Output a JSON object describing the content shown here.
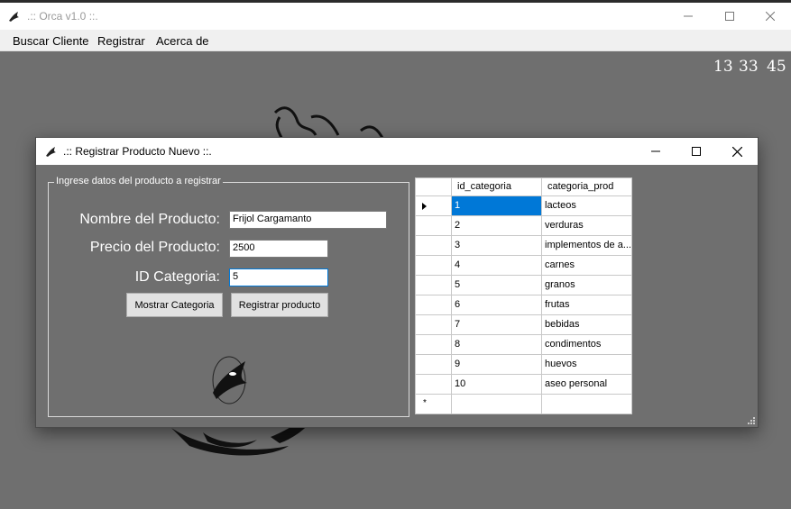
{
  "app": {
    "title": ".:: Orca v1.0 ::.",
    "icon": "orca-icon"
  },
  "menu": {
    "items": [
      "Buscar Cliente",
      "Registrar",
      "Acerca de"
    ]
  },
  "clock": {
    "hours": "13",
    "minutes": "33",
    "seconds": "45"
  },
  "dialog": {
    "title": ".:: Registrar Producto Nuevo ::.",
    "group_title": "Ingrese datos del producto a registrar",
    "labels": {
      "nombre": "Nombre del Producto:",
      "precio": "Precio del Producto:",
      "categoria": "ID Categoria:"
    },
    "fields": {
      "nombre": "Frijol Cargamanto",
      "precio": "2500",
      "categoria": "5"
    },
    "buttons": {
      "mostrar": "Mostrar Categoria",
      "registrar": "Registrar producto"
    }
  },
  "grid": {
    "columns": [
      "id_categoria",
      "categoria_prod"
    ],
    "rows": [
      [
        "1",
        "lacteos"
      ],
      [
        "2",
        "verduras"
      ],
      [
        "3",
        "implementos de a..."
      ],
      [
        "4",
        "carnes"
      ],
      [
        "5",
        "granos"
      ],
      [
        "6",
        "frutas"
      ],
      [
        "7",
        "bebidas"
      ],
      [
        "8",
        "condimentos"
      ],
      [
        "9",
        "huevos"
      ],
      [
        "10",
        "aseo personal"
      ]
    ],
    "selected_row": 0,
    "new_row_marker": "*"
  },
  "colors": {
    "accent": "#0078d7",
    "background": "#6f6f6f"
  }
}
